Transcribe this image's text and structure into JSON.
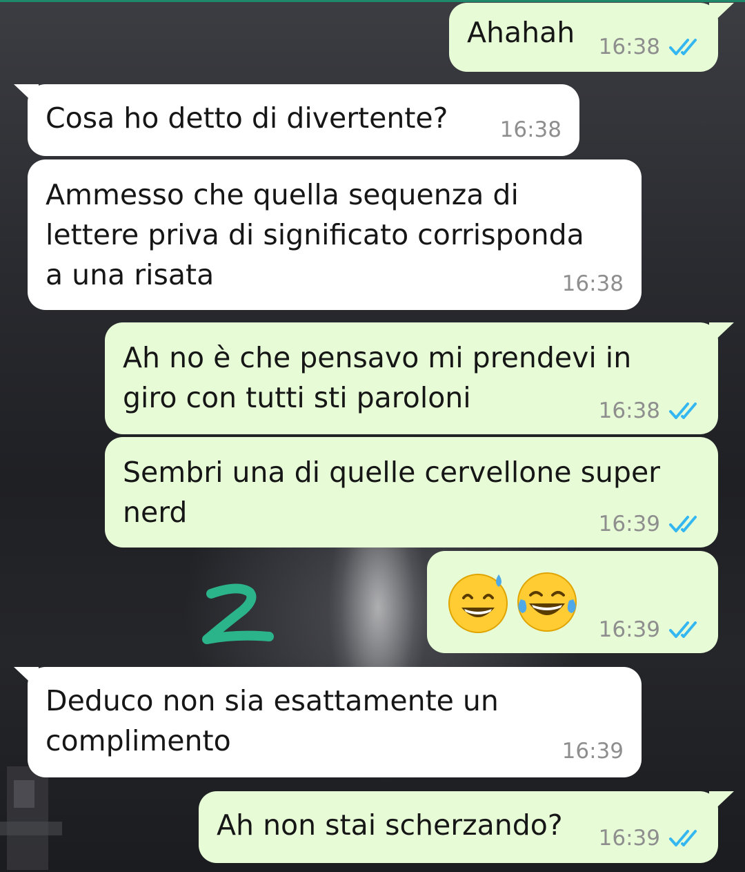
{
  "colors": {
    "incoming_bubble": "#ffffff",
    "outgoing_bubble": "#e6fbd6",
    "read_ticks": "#34b7f1",
    "timestamp": "#8e8e8e",
    "annotation": "#2bb48a"
  },
  "messages": [
    {
      "direction": "out",
      "text": "Ahahah",
      "time": "16:38",
      "status": "read-ticks-icon"
    },
    {
      "direction": "in",
      "text": "Cosa ho detto di divertente?",
      "time": "16:38"
    },
    {
      "direction": "in",
      "text": "Ammesso che quella sequenza di\nlettere priva di significato corrisponda\na una risata",
      "time": "16:38"
    },
    {
      "direction": "out",
      "text": "Ah no è che pensavo mi prendevi in\ngiro con tutti sti paroloni",
      "time": "16:38",
      "status": "read-ticks-icon"
    },
    {
      "direction": "out",
      "text": "Sembri una di quelle cervellone super\nnerd",
      "time": "16:39",
      "status": "read-ticks-icon"
    },
    {
      "direction": "out",
      "text": "",
      "emojis": [
        "grinning-sweat-emoji",
        "tears-of-joy-emoji"
      ],
      "time": "16:39",
      "status": "read-ticks-icon"
    },
    {
      "direction": "in",
      "text": "Deduco non sia esattamente un\ncomplimento",
      "time": "16:39"
    },
    {
      "direction": "out",
      "text": "Ah non stai scherzando?",
      "time": "16:39",
      "status": "read-ticks-icon"
    }
  ],
  "annotation": {
    "label": "2"
  }
}
